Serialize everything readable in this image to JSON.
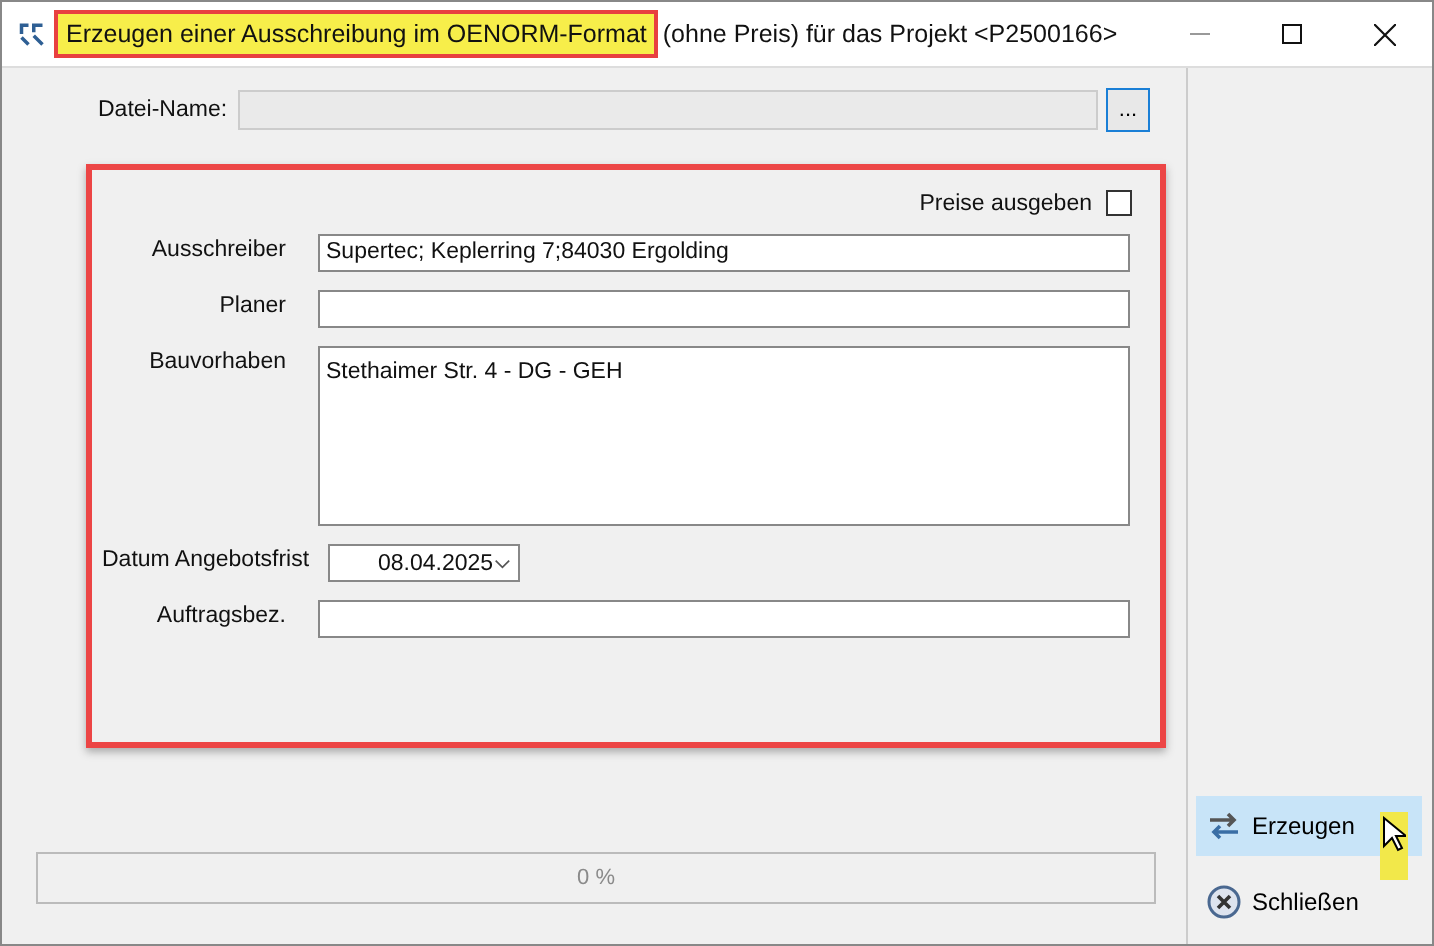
{
  "window": {
    "title_marked": "Erzeugen einer Ausschreibung im OENORM-Format",
    "title_rest": "(ohne Preis) für das Projekt <P2500166>"
  },
  "file": {
    "label": "Datei-Name:",
    "browse": "..."
  },
  "prices": {
    "label": "Preise ausgeben",
    "checked": false
  },
  "fields": [
    {
      "kind": "text",
      "label": "Ausschreiber",
      "value": "Supertec; Keplerring 7;84030 Ergolding"
    },
    {
      "kind": "text",
      "label": "Planer"
    },
    {
      "kind": "textarea",
      "label": "Bauvorhaben",
      "value": "Stethaimer Str. 4 - DG - GEH"
    },
    {
      "kind": "date",
      "label": "Datum Angebotsfrist",
      "value": "08.04.2025"
    },
    {
      "kind": "text",
      "label": "Auftragsbez."
    }
  ],
  "progress": {
    "level": 0,
    "reading": "0 %"
  },
  "buttons": [
    {
      "kind": "create",
      "label": "Erzeugen",
      "highlighted": true
    },
    {
      "kind": "close",
      "label": "Schließen",
      "highlighted": false
    }
  ]
}
